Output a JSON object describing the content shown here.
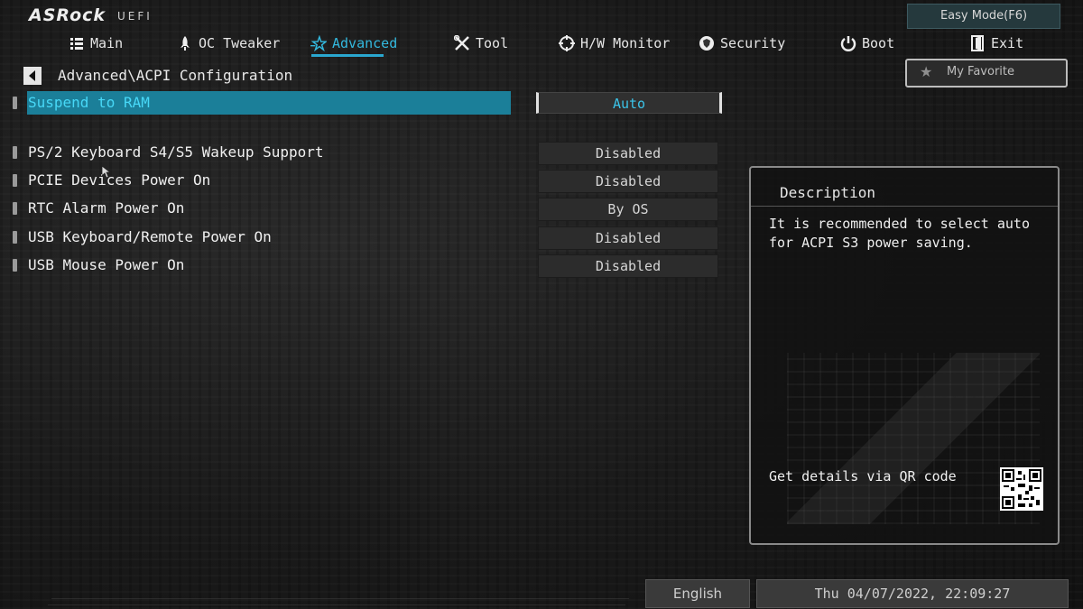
{
  "brand": {
    "logo": "ASRock",
    "sub": "UEFI"
  },
  "top": {
    "easy_mode": "Easy Mode(F6)"
  },
  "nav": [
    {
      "label": "Main",
      "icon": "list-icon"
    },
    {
      "label": "OC Tweaker",
      "icon": "rocket-icon"
    },
    {
      "label": "Advanced",
      "icon": "star-icon",
      "active": true
    },
    {
      "label": "Tool",
      "icon": "tools-icon"
    },
    {
      "label": "H/W Monitor",
      "icon": "crosshair-icon"
    },
    {
      "label": "Security",
      "icon": "shield-icon"
    },
    {
      "label": "Boot",
      "icon": "power-icon"
    },
    {
      "label": "Exit",
      "icon": "exit-icon"
    }
  ],
  "breadcrumb": "Advanced\\ACPI Configuration",
  "favorite": {
    "label": "My Favorite"
  },
  "settings": [
    {
      "label": "Suspend to RAM",
      "value": "Auto",
      "selected": true
    },
    {
      "label": "PS/2 Keyboard S4/S5 Wakeup Support",
      "value": "Disabled"
    },
    {
      "label": "PCIE Devices Power On",
      "value": "Disabled"
    },
    {
      "label": "RTC Alarm Power On",
      "value": "By OS"
    },
    {
      "label": "USB Keyboard/Remote Power On",
      "value": "Disabled"
    },
    {
      "label": "USB Mouse Power On",
      "value": "Disabled"
    }
  ],
  "description": {
    "title": "Description",
    "text": "It is recommended to select auto for ACPI S3 power saving.",
    "qr_text": "Get details via QR code"
  },
  "footer": {
    "language": "English",
    "datetime": "Thu 04/07/2022, 22:09:27"
  },
  "colors": {
    "accent": "#33b9df",
    "selected_bg": "#1b7f99"
  }
}
